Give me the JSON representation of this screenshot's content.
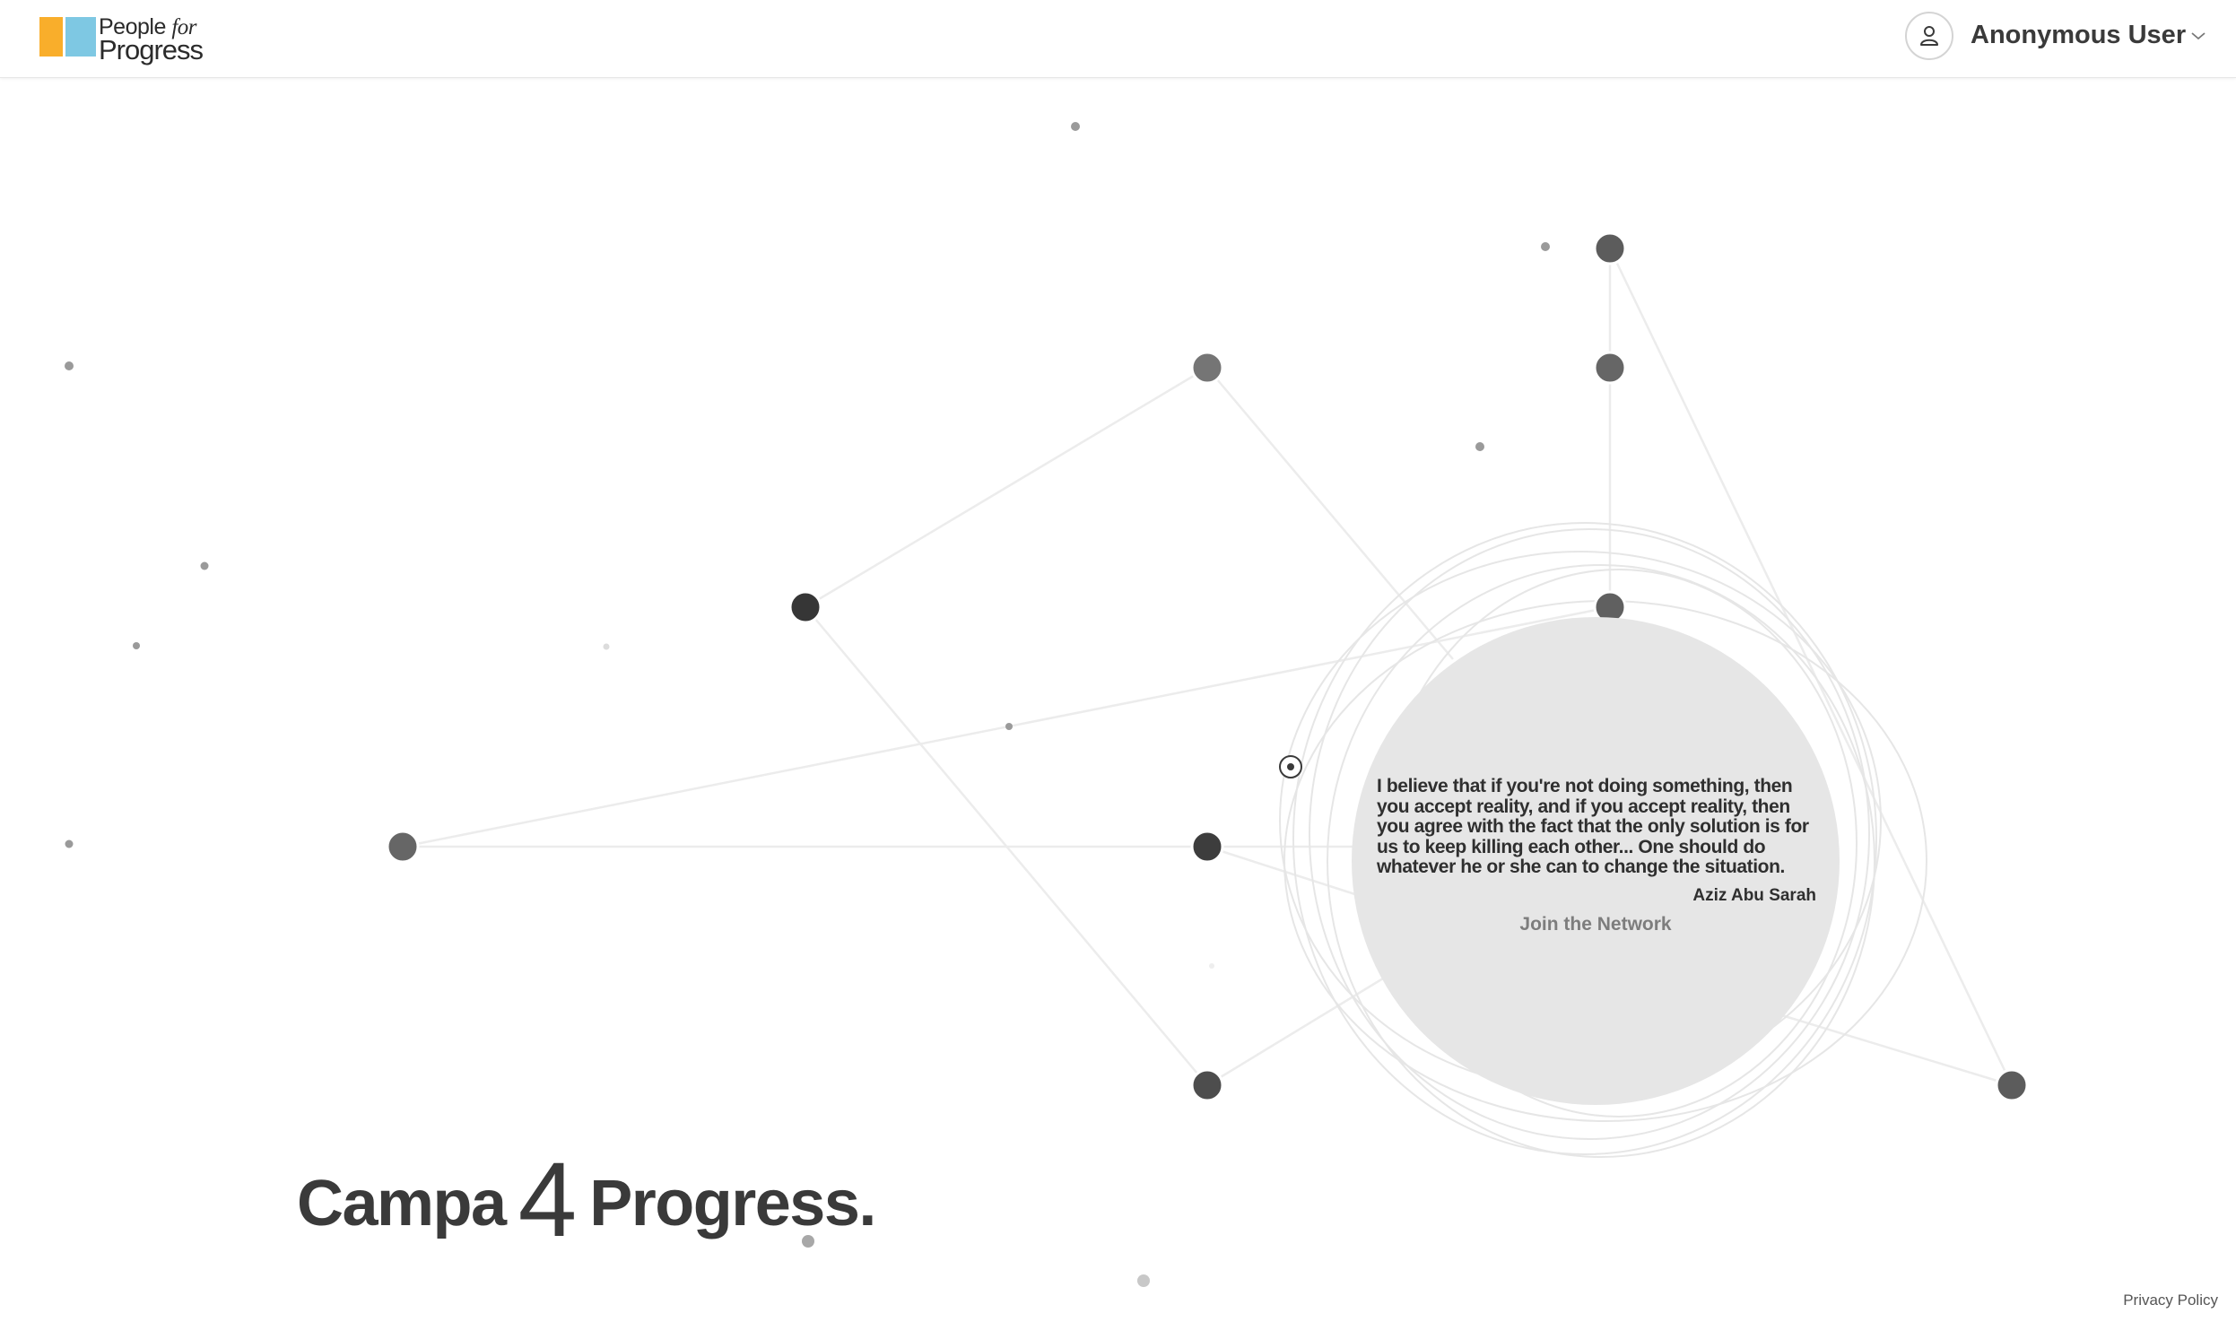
{
  "header": {
    "logo": {
      "line1": "People",
      "line1_italic": "for",
      "line2": "Progress",
      "colors": {
        "orange": "#f9ae2b",
        "blue": "#7ec8e3"
      }
    },
    "user": {
      "name": "Anonymous User",
      "avatar_icon": "person-icon",
      "menu_icon": "chevron-down-icon"
    }
  },
  "quote": {
    "text": "I believe that if you're not doing something, then you accept reality, and if you accept reality, then you agree with the fact that the only solution is for us to keep killing each other... One should do whatever he or she can to change the situation.",
    "author": "Aziz Abu Sarah"
  },
  "join_label": "Join the Network",
  "headline": {
    "part1": "Campa",
    "num": "4",
    "part2": "Progress."
  },
  "footer": {
    "privacy_label": "Privacy Policy"
  }
}
